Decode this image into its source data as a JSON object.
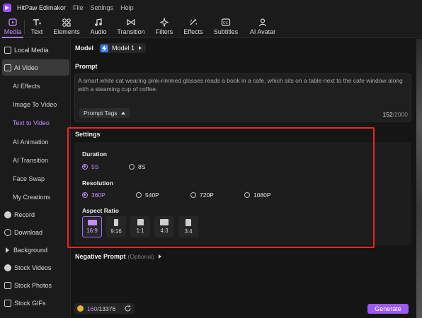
{
  "app": {
    "name": "HitPaw Edimakor",
    "menu": [
      "File",
      "Settings",
      "Help"
    ]
  },
  "toolbar": {
    "items": [
      {
        "label": "Media",
        "icon": "media-icon",
        "active": true
      },
      {
        "label": "Text",
        "icon": "text-icon"
      },
      {
        "label": "Elements",
        "icon": "elements-icon"
      },
      {
        "label": "Audio",
        "icon": "audio-icon"
      },
      {
        "label": "Transition",
        "icon": "transition-icon"
      },
      {
        "label": "Filters",
        "icon": "filters-icon"
      },
      {
        "label": "Effects",
        "icon": "effects-icon"
      },
      {
        "label": "Subtitles",
        "icon": "subtitles-icon"
      },
      {
        "label": "AI Avatar",
        "icon": "ai-avatar-icon"
      }
    ]
  },
  "sidebar": {
    "items": [
      {
        "label": "Local Media",
        "icon": "folder-icon"
      },
      {
        "label": "AI Video",
        "icon": "ai-video-icon",
        "selected": true
      },
      {
        "label": "AI Effects",
        "sub": true
      },
      {
        "label": "Image To Video",
        "sub": true
      },
      {
        "label": "Text to Video",
        "sub": true,
        "active": true
      },
      {
        "label": "AI Animation",
        "sub": true
      },
      {
        "label": "AI Transition",
        "sub": true
      },
      {
        "label": "Face Swap",
        "sub": true
      },
      {
        "label": "My Creations",
        "sub": true
      },
      {
        "label": "Record",
        "icon": "record-icon"
      },
      {
        "label": "Download",
        "icon": "download-icon"
      },
      {
        "label": "Background",
        "icon": "background-icon"
      },
      {
        "label": "Stock Videos",
        "icon": "stock-videos-icon"
      },
      {
        "label": "Stock Photos",
        "icon": "stock-photos-icon"
      },
      {
        "label": "Stock GIFs",
        "icon": "stock-gifs-icon"
      }
    ]
  },
  "model": {
    "label": "Model",
    "value": "Model 1"
  },
  "prompt": {
    "title": "Prompt",
    "text": "A smart white cat wearing pink-rimmed glasses reads a book in a cafe, which sits on a table next to the cafe window along with a steaming cup of coffee.",
    "tags_label": "Prompt Tags",
    "count": "152",
    "max": "/2000"
  },
  "settings": {
    "title": "Settings",
    "duration": {
      "label": "Duration",
      "options": [
        "5S",
        "8S"
      ],
      "selected": "5S"
    },
    "resolution": {
      "label": "Resolution",
      "options": [
        "360P",
        "540P",
        "720P",
        "1080P"
      ],
      "selected": "360P"
    },
    "aspect": {
      "label": "Aspect Ratio",
      "options": [
        "16:9",
        "9:16",
        "1:1",
        "4:3",
        "3:4"
      ],
      "selected": "16:9"
    }
  },
  "negative": {
    "label": "Negative Prompt",
    "optional": "(Optional)"
  },
  "footer": {
    "credits_used": "160",
    "credits_total": "/13376",
    "generate_label": "Generate"
  },
  "colors": {
    "accent": "#c68cff",
    "generate": "#9d58f0",
    "highlight_frame": "#e8262c"
  }
}
